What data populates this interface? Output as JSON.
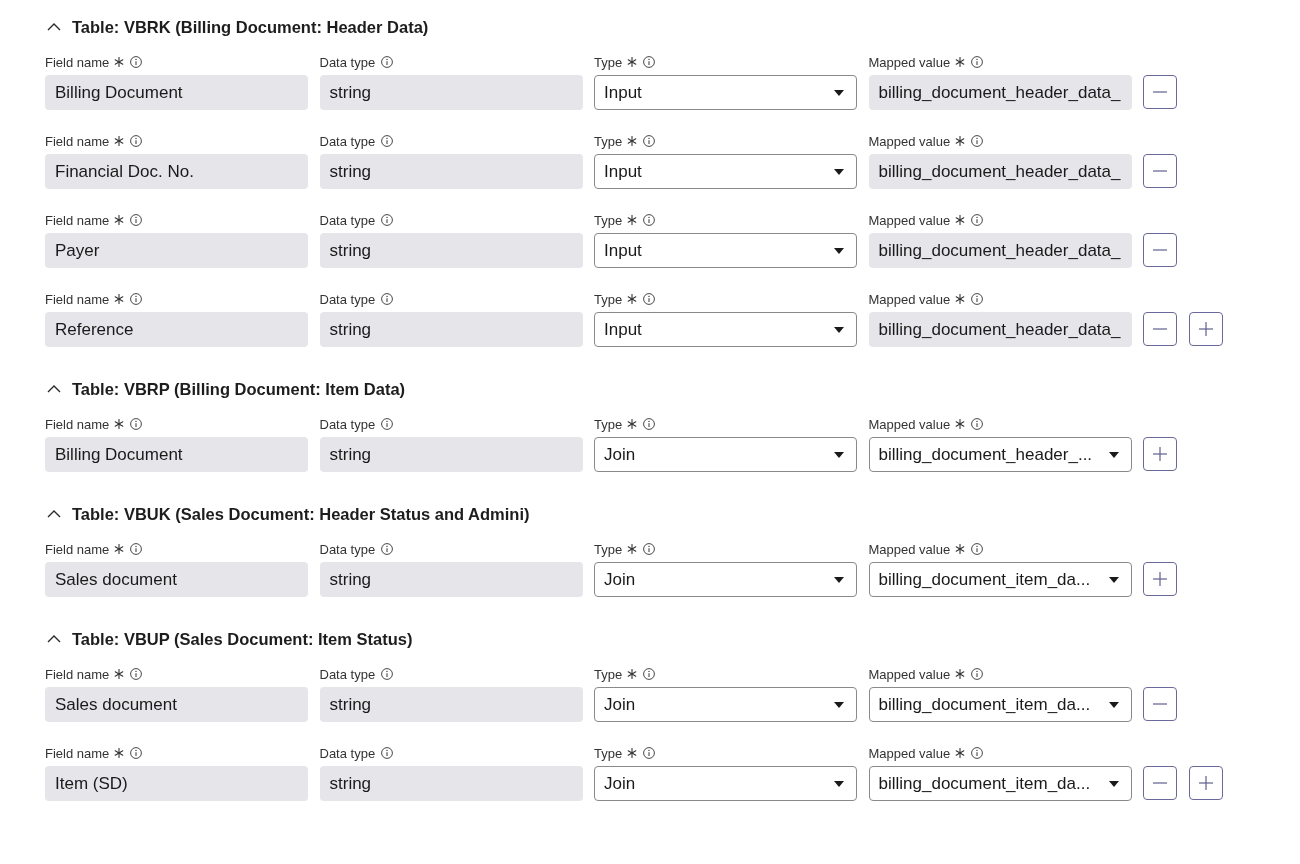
{
  "sections": [
    {
      "title": "Table: VBRK (Billing Document: Header Data)",
      "expanded": true,
      "rows": [
        {
          "fields": [
            {
              "label": "Field name",
              "required": true,
              "kind": "text",
              "value": "Billing Document"
            },
            {
              "label": "Data type",
              "required": false,
              "kind": "text",
              "value": "string"
            },
            {
              "label": "Type",
              "required": true,
              "kind": "select",
              "value": "Input"
            },
            {
              "label": "Mapped value",
              "required": true,
              "kind": "text",
              "value": "billing_document_header_data_"
            }
          ],
          "buttons": [
            {
              "kind": "remove"
            }
          ]
        },
        {
          "fields": [
            {
              "label": "Field name",
              "required": true,
              "kind": "text",
              "value": "Financial Doc. No."
            },
            {
              "label": "Data type",
              "required": false,
              "kind": "text",
              "value": "string"
            },
            {
              "label": "Type",
              "required": true,
              "kind": "select",
              "value": "Input"
            },
            {
              "label": "Mapped value",
              "required": true,
              "kind": "text",
              "value": "billing_document_header_data_"
            }
          ],
          "buttons": [
            {
              "kind": "remove"
            }
          ]
        },
        {
          "fields": [
            {
              "label": "Field name",
              "required": true,
              "kind": "text",
              "value": "Payer"
            },
            {
              "label": "Data type",
              "required": false,
              "kind": "text",
              "value": "string"
            },
            {
              "label": "Type",
              "required": true,
              "kind": "select",
              "value": "Input"
            },
            {
              "label": "Mapped value",
              "required": true,
              "kind": "text",
              "value": "billing_document_header_data_"
            }
          ],
          "buttons": [
            {
              "kind": "remove"
            }
          ]
        },
        {
          "fields": [
            {
              "label": "Field name",
              "required": true,
              "kind": "text",
              "value": "Reference"
            },
            {
              "label": "Data type",
              "required": false,
              "kind": "text",
              "value": "string"
            },
            {
              "label": "Type",
              "required": true,
              "kind": "select",
              "value": "Input"
            },
            {
              "label": "Mapped value",
              "required": true,
              "kind": "text",
              "value": "billing_document_header_data_"
            }
          ],
          "buttons": [
            {
              "kind": "remove"
            },
            {
              "kind": "add"
            }
          ]
        }
      ]
    },
    {
      "title": "Table: VBRP (Billing Document: Item Data)",
      "expanded": true,
      "rows": [
        {
          "fields": [
            {
              "label": "Field name",
              "required": true,
              "kind": "text",
              "value": "Billing Document"
            },
            {
              "label": "Data type",
              "required": false,
              "kind": "text",
              "value": "string"
            },
            {
              "label": "Type",
              "required": true,
              "kind": "select",
              "value": "Join"
            },
            {
              "label": "Mapped value",
              "required": true,
              "kind": "select",
              "value": "billing_document_header_..."
            }
          ],
          "buttons": [
            {
              "kind": "add"
            }
          ]
        }
      ]
    },
    {
      "title": "Table: VBUK (Sales Document: Header Status and Admini)",
      "expanded": true,
      "rows": [
        {
          "fields": [
            {
              "label": "Field name",
              "required": true,
              "kind": "text",
              "value": "Sales document"
            },
            {
              "label": "Data type",
              "required": false,
              "kind": "text",
              "value": "string"
            },
            {
              "label": "Type",
              "required": true,
              "kind": "select",
              "value": "Join"
            },
            {
              "label": "Mapped value",
              "required": true,
              "kind": "select",
              "value": "billing_document_item_da..."
            }
          ],
          "buttons": [
            {
              "kind": "add"
            }
          ]
        }
      ]
    },
    {
      "title": "Table: VBUP (Sales Document: Item Status)",
      "expanded": true,
      "rows": [
        {
          "fields": [
            {
              "label": "Field name",
              "required": true,
              "kind": "text",
              "value": "Sales document"
            },
            {
              "label": "Data type",
              "required": false,
              "kind": "text",
              "value": "string"
            },
            {
              "label": "Type",
              "required": true,
              "kind": "select",
              "value": "Join"
            },
            {
              "label": "Mapped value",
              "required": true,
              "kind": "select",
              "value": "billing_document_item_da..."
            }
          ],
          "buttons": [
            {
              "kind": "remove"
            }
          ]
        },
        {
          "fields": [
            {
              "label": "Field name",
              "required": true,
              "kind": "text",
              "value": "Item (SD)"
            },
            {
              "label": "Data type",
              "required": false,
              "kind": "text",
              "value": "string"
            },
            {
              "label": "Type",
              "required": true,
              "kind": "select",
              "value": "Join"
            },
            {
              "label": "Mapped value",
              "required": true,
              "kind": "select",
              "value": "billing_document_item_da..."
            }
          ],
          "buttons": [
            {
              "kind": "remove"
            },
            {
              "kind": "add"
            }
          ]
        }
      ]
    }
  ]
}
